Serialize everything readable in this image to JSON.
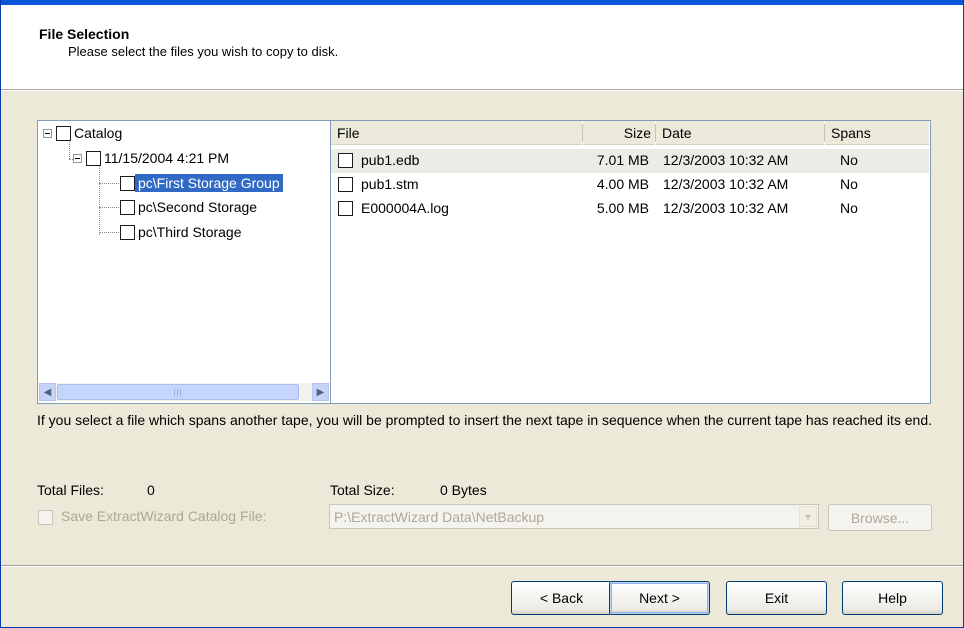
{
  "header": {
    "title": "File Selection",
    "subtitle": "Please select the files you wish to copy to disk."
  },
  "tree": {
    "nodes": [
      {
        "label": "Catalog",
        "checked": false,
        "expanded": true
      },
      {
        "label": "11/15/2004 4:21 PM",
        "checked": false,
        "expanded": true
      },
      {
        "label": "pc\\First Storage Group",
        "checked": false,
        "selected": true
      },
      {
        "label": "pc\\Second Storage",
        "checked": false
      },
      {
        "label": "pc\\Third Storage",
        "checked": false
      }
    ]
  },
  "file_list": {
    "columns": [
      "File",
      "Size",
      "Date",
      "Spans"
    ],
    "rows": [
      {
        "file": "pub1.edb",
        "size": "7.01 MB",
        "date": "12/3/2003 10:32 AM",
        "spans": "No",
        "checked": false
      },
      {
        "file": "pub1.stm",
        "size": "4.00 MB",
        "date": "12/3/2003 10:32 AM",
        "spans": "No",
        "checked": false
      },
      {
        "file": "E000004A.log",
        "size": "5.00 MB",
        "date": "12/3/2003 10:32 AM",
        "spans": "No",
        "checked": false
      }
    ]
  },
  "info_text": "If you select a file which spans another tape, you will be prompted to insert the next tape in sequence when the current tape has reached its end.",
  "totals": {
    "files_label": "Total Files:",
    "files_value": "0",
    "size_label": "Total Size:",
    "size_value": "0 Bytes"
  },
  "save_catalog": {
    "label": "Save ExtractWizard Catalog File:",
    "checked": false,
    "enabled": false,
    "path": "P:\\ExtractWizard Data\\NetBackup",
    "browse_label": "Browse..."
  },
  "buttons": {
    "back": "< Back",
    "next": "Next >",
    "exit": "Exit",
    "help": "Help"
  },
  "colors": {
    "selection": "#316ac5",
    "dialog_bg": "#ece9d8",
    "window_border": "#0a56d8"
  }
}
